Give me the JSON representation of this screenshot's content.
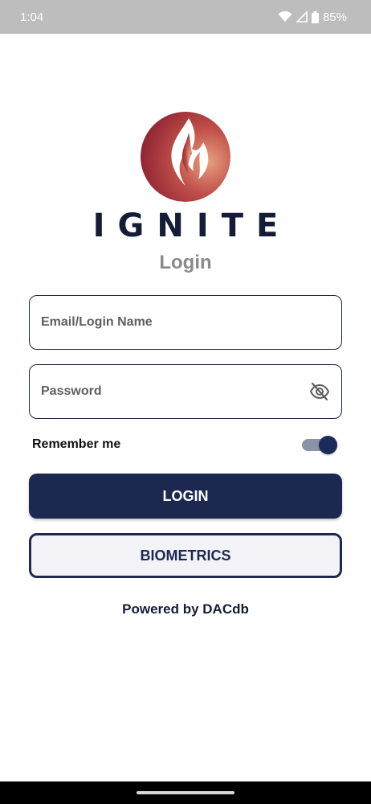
{
  "status_bar": {
    "time": "1:04",
    "battery": "85%",
    "icons": [
      "wifi-icon",
      "signal-icon",
      "battery-icon"
    ]
  },
  "brand": {
    "name": "IGNITE",
    "logo_icon": "flame-logo-icon",
    "logo_colors": [
      "#8e2333",
      "#e08a6e"
    ]
  },
  "login": {
    "title": "Login",
    "email_placeholder": "Email/Login Name",
    "email_value": "",
    "password_placeholder": "Password",
    "password_value": "",
    "password_icon": "eye-off-icon",
    "remember_label": "Remember me",
    "remember_enabled": true,
    "login_button": "LOGIN",
    "biometrics_button": "BIOMETRICS"
  },
  "footer": {
    "powered_by": "Powered by DACdb"
  },
  "colors": {
    "primary": "#1c2850",
    "title_gray": "#8a8a8a",
    "status_bar": "#bdbdbd"
  }
}
